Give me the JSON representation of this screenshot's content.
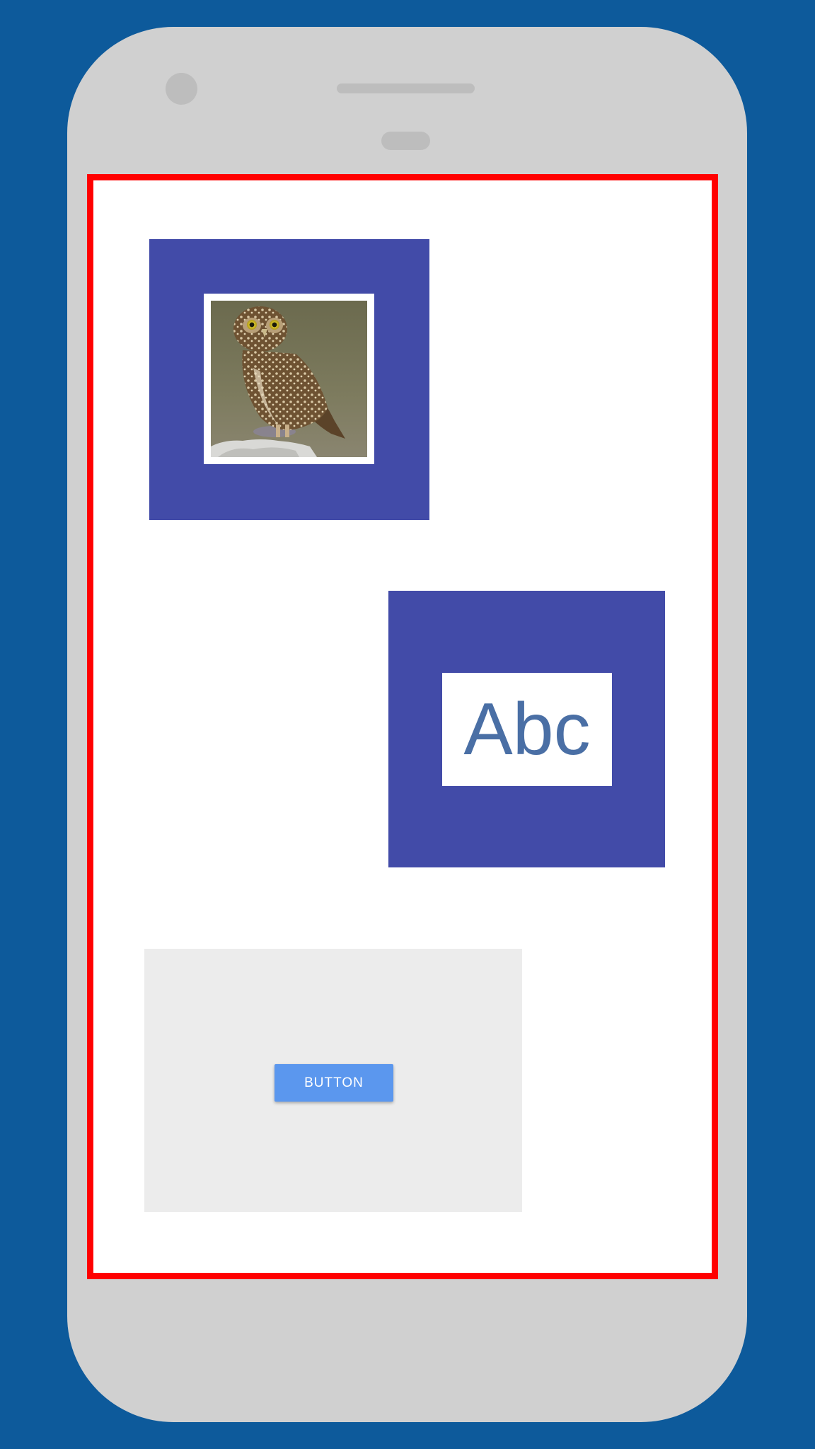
{
  "device": {
    "frame_color": "#d0d0d0",
    "background_color": "#0d5a9b",
    "screen_border_color": "#ff0000"
  },
  "image_card": {
    "image_icon": "owl-photo",
    "card_color": "#424ba8"
  },
  "text_card": {
    "text": "Abc",
    "text_color": "#4a6fa5",
    "card_color": "#424ba8"
  },
  "button_panel": {
    "button_label": "BUTTON",
    "button_color": "#5b97ee",
    "panel_color": "#ececec"
  }
}
